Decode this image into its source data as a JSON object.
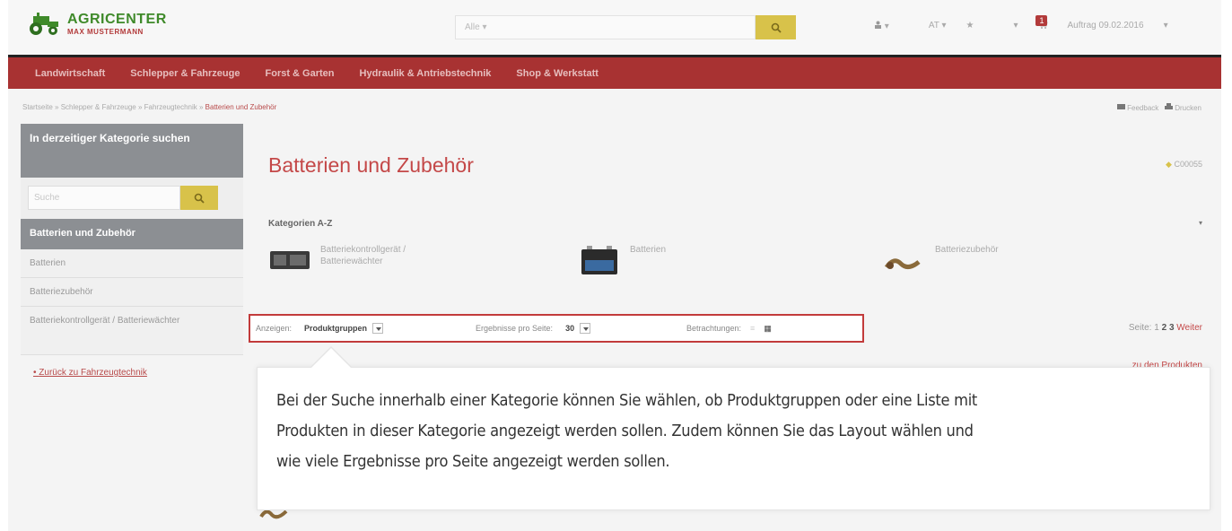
{
  "header": {
    "brand_line1": "AGRICENTER",
    "brand_line2": "MAX MUSTERMANN",
    "search_scope": "Alle ▾",
    "user_menu": "▾",
    "language": "AT ▾",
    "favorites": "★",
    "favorites_caret": "▾",
    "cart_count": "1",
    "order_label": "Auftrag 09.02.2016",
    "order_caret": "▾"
  },
  "nav": {
    "items": [
      "Landwirtschaft",
      "Schlepper & Fahrzeuge",
      "Forst & Garten",
      "Hydraulik & Antriebstechnik",
      "Shop & Werkstatt"
    ]
  },
  "breadcrumb": {
    "path": "Startseite » Schlepper & Fahrzeuge » Fahrzeugtechnik » ",
    "current": "Batterien und Zubehör",
    "feedback": "Feedback",
    "print": "Drucken"
  },
  "sidebar": {
    "heading": "In derzeitiger Kategorie suchen",
    "search_placeholder": "Suche",
    "category": "Batterien und Zubehör",
    "items": [
      "Batterien",
      "Batteriezubehör",
      "Batteriekontrollgerät / Batteriewächter"
    ],
    "back_link": "Zurück zu Fahrzeugtechnik"
  },
  "main": {
    "title": "Batterien und Zubehör",
    "code": "C00055",
    "categories_label": "Kategorien A-Z",
    "categories": [
      {
        "label": "Batteriekontrollgerät / Batteriewächter"
      },
      {
        "label": "Batterien"
      },
      {
        "label": "Batteriezubehör"
      }
    ],
    "toolbar": {
      "show_label": "Anzeigen:",
      "show_value": "Produktgruppen",
      "per_page_label": "Ergebnisse pro Seite:",
      "per_page_value": "30",
      "view_label": "Betrachtungen:"
    },
    "pager": {
      "label": "Seite:",
      "pages": [
        "1",
        "2",
        "3"
      ],
      "next": "Weiter"
    },
    "result_link": "zu den Produkten"
  },
  "callout": {
    "text_line1": "Bei der Suche innerhalb einer Kategorie können Sie wählen, ob Produktgruppen oder eine Liste mit",
    "text_line2": "Produkten in dieser Kategorie angezeigt werden sollen. Zudem können Sie das Layout wählen und",
    "text_line3": "wie viele Ergebnisse pro Seite angezeigt werden sollen."
  },
  "colors": {
    "brand_red": "#a83232",
    "accent_yellow": "#d8c24a",
    "brand_green": "#3f8a2a",
    "highlight_border": "#c23b3b"
  }
}
